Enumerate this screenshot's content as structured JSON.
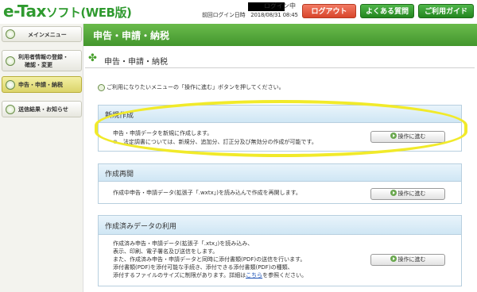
{
  "header": {
    "logo_main": "e-Tax",
    "logo_sub": "ソフト(WEB版)",
    "login_status": "ログイン中",
    "last_login": "前回ログイン日時　2018/08/31 08:45",
    "logout_label": "ログアウト",
    "faq_label": "よくある質問",
    "guide_label": "ご利用ガイド"
  },
  "sidebar": {
    "items": [
      {
        "label": "メインメニュー"
      },
      {
        "label1": "利用者情報の登録・",
        "label2": "確認・変更"
      },
      {
        "label": "申告・申請・納税"
      },
      {
        "label": "送信結果・お知らせ"
      }
    ]
  },
  "main": {
    "band_title": "申告・申請・納税",
    "section_title": "申告・申請・納税",
    "hint": "ご利用になりたいメニューの「操作に進む」ボタンを押してください。",
    "cards": [
      {
        "title": "新規作成",
        "lines": [
          "申告・申請データを新規に作成します。",
          "※　法定調書については、新規分、追加分、訂正分及び無効分の作成が可能です。"
        ],
        "button": "操作に進む"
      },
      {
        "title": "作成再開",
        "lines": [
          "作成中申告・申請データ(拡張子「.wxtx」)を読み込んで作成を再開します。"
        ],
        "button": "操作に進む"
      },
      {
        "title": "作成済みデータの利用",
        "lines": [
          "作成済み申告・申請データ(拡張子「.xtx」)を読み込み、",
          "表示、印刷、電子署名及び送信をします。",
          "また、作成済み申告・申請データと同時に添付書類(PDF)の送信を行います。",
          "添付書類(PDF)を添付可能な手続き、添付できる添付書類(PDF)の種類、",
          "添付するファイルのサイズに制限があります。詳細は"
        ],
        "link": "こちら",
        "line_tail": "を参照ください。",
        "button": "操作に進む"
      }
    ]
  },
  "colors": {
    "brand_green": "#43962d",
    "logout_red": "#d8452b",
    "highlight_yellow": "#f1ea2a"
  }
}
